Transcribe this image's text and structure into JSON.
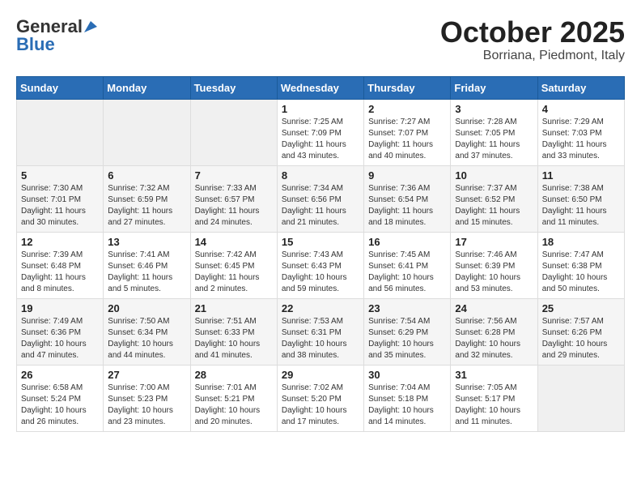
{
  "header": {
    "logo_general": "General",
    "logo_blue": "Blue",
    "month": "October 2025",
    "location": "Borriana, Piedmont, Italy"
  },
  "weekdays": [
    "Sunday",
    "Monday",
    "Tuesday",
    "Wednesday",
    "Thursday",
    "Friday",
    "Saturday"
  ],
  "weeks": [
    [
      {
        "day": "",
        "sunrise": "",
        "sunset": "",
        "daylight": ""
      },
      {
        "day": "",
        "sunrise": "",
        "sunset": "",
        "daylight": ""
      },
      {
        "day": "",
        "sunrise": "",
        "sunset": "",
        "daylight": ""
      },
      {
        "day": "1",
        "sunrise": "Sunrise: 7:25 AM",
        "sunset": "Sunset: 7:09 PM",
        "daylight": "Daylight: 11 hours and 43 minutes."
      },
      {
        "day": "2",
        "sunrise": "Sunrise: 7:27 AM",
        "sunset": "Sunset: 7:07 PM",
        "daylight": "Daylight: 11 hours and 40 minutes."
      },
      {
        "day": "3",
        "sunrise": "Sunrise: 7:28 AM",
        "sunset": "Sunset: 7:05 PM",
        "daylight": "Daylight: 11 hours and 37 minutes."
      },
      {
        "day": "4",
        "sunrise": "Sunrise: 7:29 AM",
        "sunset": "Sunset: 7:03 PM",
        "daylight": "Daylight: 11 hours and 33 minutes."
      }
    ],
    [
      {
        "day": "5",
        "sunrise": "Sunrise: 7:30 AM",
        "sunset": "Sunset: 7:01 PM",
        "daylight": "Daylight: 11 hours and 30 minutes."
      },
      {
        "day": "6",
        "sunrise": "Sunrise: 7:32 AM",
        "sunset": "Sunset: 6:59 PM",
        "daylight": "Daylight: 11 hours and 27 minutes."
      },
      {
        "day": "7",
        "sunrise": "Sunrise: 7:33 AM",
        "sunset": "Sunset: 6:57 PM",
        "daylight": "Daylight: 11 hours and 24 minutes."
      },
      {
        "day": "8",
        "sunrise": "Sunrise: 7:34 AM",
        "sunset": "Sunset: 6:56 PM",
        "daylight": "Daylight: 11 hours and 21 minutes."
      },
      {
        "day": "9",
        "sunrise": "Sunrise: 7:36 AM",
        "sunset": "Sunset: 6:54 PM",
        "daylight": "Daylight: 11 hours and 18 minutes."
      },
      {
        "day": "10",
        "sunrise": "Sunrise: 7:37 AM",
        "sunset": "Sunset: 6:52 PM",
        "daylight": "Daylight: 11 hours and 15 minutes."
      },
      {
        "day": "11",
        "sunrise": "Sunrise: 7:38 AM",
        "sunset": "Sunset: 6:50 PM",
        "daylight": "Daylight: 11 hours and 11 minutes."
      }
    ],
    [
      {
        "day": "12",
        "sunrise": "Sunrise: 7:39 AM",
        "sunset": "Sunset: 6:48 PM",
        "daylight": "Daylight: 11 hours and 8 minutes."
      },
      {
        "day": "13",
        "sunrise": "Sunrise: 7:41 AM",
        "sunset": "Sunset: 6:46 PM",
        "daylight": "Daylight: 11 hours and 5 minutes."
      },
      {
        "day": "14",
        "sunrise": "Sunrise: 7:42 AM",
        "sunset": "Sunset: 6:45 PM",
        "daylight": "Daylight: 11 hours and 2 minutes."
      },
      {
        "day": "15",
        "sunrise": "Sunrise: 7:43 AM",
        "sunset": "Sunset: 6:43 PM",
        "daylight": "Daylight: 10 hours and 59 minutes."
      },
      {
        "day": "16",
        "sunrise": "Sunrise: 7:45 AM",
        "sunset": "Sunset: 6:41 PM",
        "daylight": "Daylight: 10 hours and 56 minutes."
      },
      {
        "day": "17",
        "sunrise": "Sunrise: 7:46 AM",
        "sunset": "Sunset: 6:39 PM",
        "daylight": "Daylight: 10 hours and 53 minutes."
      },
      {
        "day": "18",
        "sunrise": "Sunrise: 7:47 AM",
        "sunset": "Sunset: 6:38 PM",
        "daylight": "Daylight: 10 hours and 50 minutes."
      }
    ],
    [
      {
        "day": "19",
        "sunrise": "Sunrise: 7:49 AM",
        "sunset": "Sunset: 6:36 PM",
        "daylight": "Daylight: 10 hours and 47 minutes."
      },
      {
        "day": "20",
        "sunrise": "Sunrise: 7:50 AM",
        "sunset": "Sunset: 6:34 PM",
        "daylight": "Daylight: 10 hours and 44 minutes."
      },
      {
        "day": "21",
        "sunrise": "Sunrise: 7:51 AM",
        "sunset": "Sunset: 6:33 PM",
        "daylight": "Daylight: 10 hours and 41 minutes."
      },
      {
        "day": "22",
        "sunrise": "Sunrise: 7:53 AM",
        "sunset": "Sunset: 6:31 PM",
        "daylight": "Daylight: 10 hours and 38 minutes."
      },
      {
        "day": "23",
        "sunrise": "Sunrise: 7:54 AM",
        "sunset": "Sunset: 6:29 PM",
        "daylight": "Daylight: 10 hours and 35 minutes."
      },
      {
        "day": "24",
        "sunrise": "Sunrise: 7:56 AM",
        "sunset": "Sunset: 6:28 PM",
        "daylight": "Daylight: 10 hours and 32 minutes."
      },
      {
        "day": "25",
        "sunrise": "Sunrise: 7:57 AM",
        "sunset": "Sunset: 6:26 PM",
        "daylight": "Daylight: 10 hours and 29 minutes."
      }
    ],
    [
      {
        "day": "26",
        "sunrise": "Sunrise: 6:58 AM",
        "sunset": "Sunset: 5:24 PM",
        "daylight": "Daylight: 10 hours and 26 minutes."
      },
      {
        "day": "27",
        "sunrise": "Sunrise: 7:00 AM",
        "sunset": "Sunset: 5:23 PM",
        "daylight": "Daylight: 10 hours and 23 minutes."
      },
      {
        "day": "28",
        "sunrise": "Sunrise: 7:01 AM",
        "sunset": "Sunset: 5:21 PM",
        "daylight": "Daylight: 10 hours and 20 minutes."
      },
      {
        "day": "29",
        "sunrise": "Sunrise: 7:02 AM",
        "sunset": "Sunset: 5:20 PM",
        "daylight": "Daylight: 10 hours and 17 minutes."
      },
      {
        "day": "30",
        "sunrise": "Sunrise: 7:04 AM",
        "sunset": "Sunset: 5:18 PM",
        "daylight": "Daylight: 10 hours and 14 minutes."
      },
      {
        "day": "31",
        "sunrise": "Sunrise: 7:05 AM",
        "sunset": "Sunset: 5:17 PM",
        "daylight": "Daylight: 10 hours and 11 minutes."
      },
      {
        "day": "",
        "sunrise": "",
        "sunset": "",
        "daylight": ""
      }
    ]
  ]
}
